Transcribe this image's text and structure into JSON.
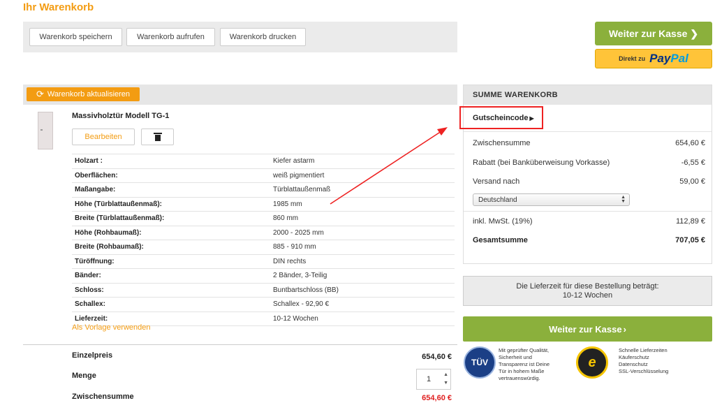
{
  "page_title": "Ihr Warenkorb",
  "toolbar": {
    "save_label": "Warenkorb speichern",
    "open_label": "Warenkorb aufrufen",
    "print_label": "Warenkorb drucken"
  },
  "checkout_top_label": "Weiter zur Kasse",
  "paypal": {
    "direkt": "Direkt zu",
    "pay": "Pay",
    "pal": "Pal"
  },
  "update_label": "Warenkorb aktualisieren",
  "product": {
    "name": "Massivholztür Modell TG-1",
    "edit_label": "Bearbeiten",
    "attributes": [
      {
        "label": "Holzart :",
        "value": "Kiefer astarm"
      },
      {
        "label": "Oberflächen:",
        "value": "weiß pigmentiert"
      },
      {
        "label": "Maßangabe:",
        "value": "Türblattaußenmaß"
      },
      {
        "label": "Höhe (Türblattaußenmaß):",
        "value": "1985 mm"
      },
      {
        "label": "Breite (Türblattaußenmaß):",
        "value": "860 mm"
      },
      {
        "label": "Höhe (Rohbaumaß):",
        "value": "2000 - 2025 mm"
      },
      {
        "label": "Breite (Rohbaumaß):",
        "value": "885 - 910 mm"
      },
      {
        "label": "Türöffnung:",
        "value": "DIN rechts"
      },
      {
        "label": "Bänder:",
        "value": "2 Bänder, 3-Teilig"
      },
      {
        "label": "Schloss:",
        "value": "Buntbartschloss (BB)"
      },
      {
        "label": "Schallex:",
        "value": "Schallex - 92,90 €"
      },
      {
        "label": "Lieferzeit:",
        "value": "10-12 Wochen"
      }
    ],
    "template_link": "Als Vorlage verwenden",
    "unit_price_label": "Einzelpreis",
    "unit_price": "654,60 €",
    "qty_label": "Menge",
    "qty": "1",
    "subtotal_label": "Zwischensumme",
    "subtotal": "654,60 €"
  },
  "summary": {
    "heading": "SUMME WARENKORB",
    "coupon_label": "Gutscheincode",
    "rows": {
      "subtotal": {
        "label": "Zwischensumme",
        "value": "654,60 €"
      },
      "discount": {
        "label": "Rabatt (bei Banküberweisung Vorkasse)",
        "value": "-6,55 €"
      },
      "shipping": {
        "label": "Versand nach",
        "value": "59,00 €"
      },
      "vat": {
        "label": "inkl. MwSt. (19%)",
        "value": "112,89 €"
      },
      "total": {
        "label": "Gesamtsumme",
        "value": "707,05 €"
      }
    },
    "country": "Deutschland"
  },
  "delivery": {
    "line1": "Die Lieferzeit für diese Bestellung beträgt:",
    "line2": "10-12 Wochen"
  },
  "checkout_bottom_label": "Weiter zur Kasse",
  "trust": {
    "tuv_badge": "TÜV",
    "tuv_text": [
      "Mit geprüfter Qualität,",
      "Sicherheit und",
      "Transparenz ist Deine",
      "Tür in hohem Maße",
      "vertrauenswürdig."
    ],
    "ts_badge": "e",
    "ts_text": [
      "Schnelle Lieferzeiten",
      "Käuferschutz",
      "Datenschutz",
      "SSL-Verschlüsselung"
    ]
  },
  "colors": {
    "accent": "#f39c12",
    "checkout": "#8bb03c",
    "highlight": "#e22222"
  }
}
